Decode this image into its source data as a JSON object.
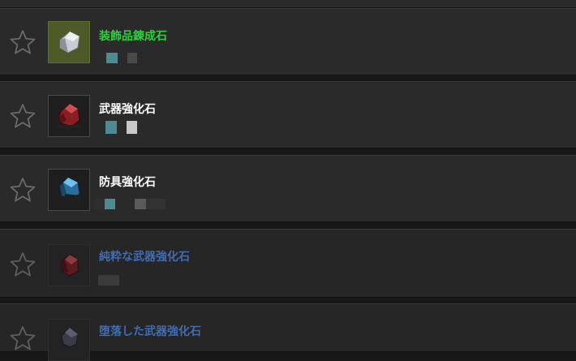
{
  "items": [
    {
      "name": "装飾品錬成石",
      "name_color": "#2bd13b",
      "icon": "silver-ore-icon",
      "favorited": false
    },
    {
      "name": "武器強化石",
      "name_color": "#ffffff",
      "icon": "red-crystal-icon",
      "favorited": false
    },
    {
      "name": "防具強化石",
      "name_color": "#ffffff",
      "icon": "blue-crystal-icon",
      "favorited": false
    },
    {
      "name": "純粋な武器強化石",
      "name_color": "#3f6cb3",
      "icon": "dark-red-crystal-icon",
      "favorited": false
    },
    {
      "name": "堕落した武器強化石",
      "name_color": "#3f6cb3",
      "icon": "dark-crystal-icon",
      "favorited": false
    }
  ]
}
